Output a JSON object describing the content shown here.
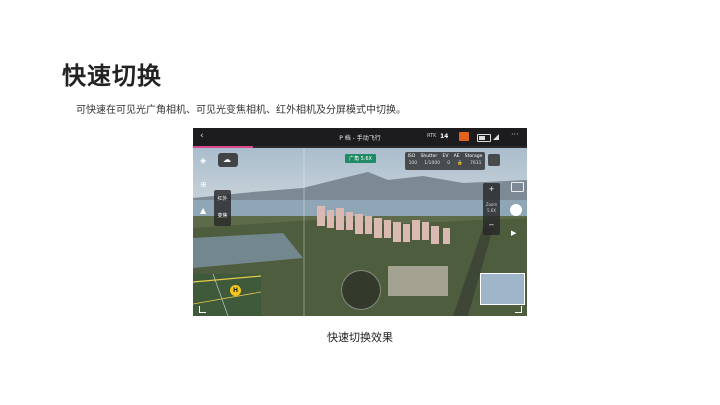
{
  "page": {
    "title": "快速切换",
    "description": "可快速在可见光广角相机、可见光变焦相机、红外相机及分屏模式中切换。",
    "caption": "快速切换效果"
  },
  "screenshot": {
    "topbar": {
      "back_icon": "chevron-left-icon",
      "mode_label": "P 档 - 手动飞行",
      "rtk_label": "RTK",
      "satellite_count": "14",
      "menu_icon": "more-icon"
    },
    "camera_tag": "广角 5.6X",
    "exif": {
      "headers": [
        "ISO",
        "Shutter",
        "EV",
        "AE",
        "Storage"
      ],
      "values": [
        "100",
        "1/1000",
        "0",
        "🔒",
        "7631"
      ]
    },
    "lens_options": [
      "红外",
      "变焦"
    ],
    "zoom": {
      "plus": "+",
      "label": "Zoom",
      "value": "5.6X",
      "minus": "−"
    },
    "home_badge": "H",
    "colors": {
      "topbar": "#1c1c1e",
      "accent_pink": "#d94a8c",
      "tag_green": "#1f8a63",
      "photo_orange": "#e0641c"
    }
  }
}
